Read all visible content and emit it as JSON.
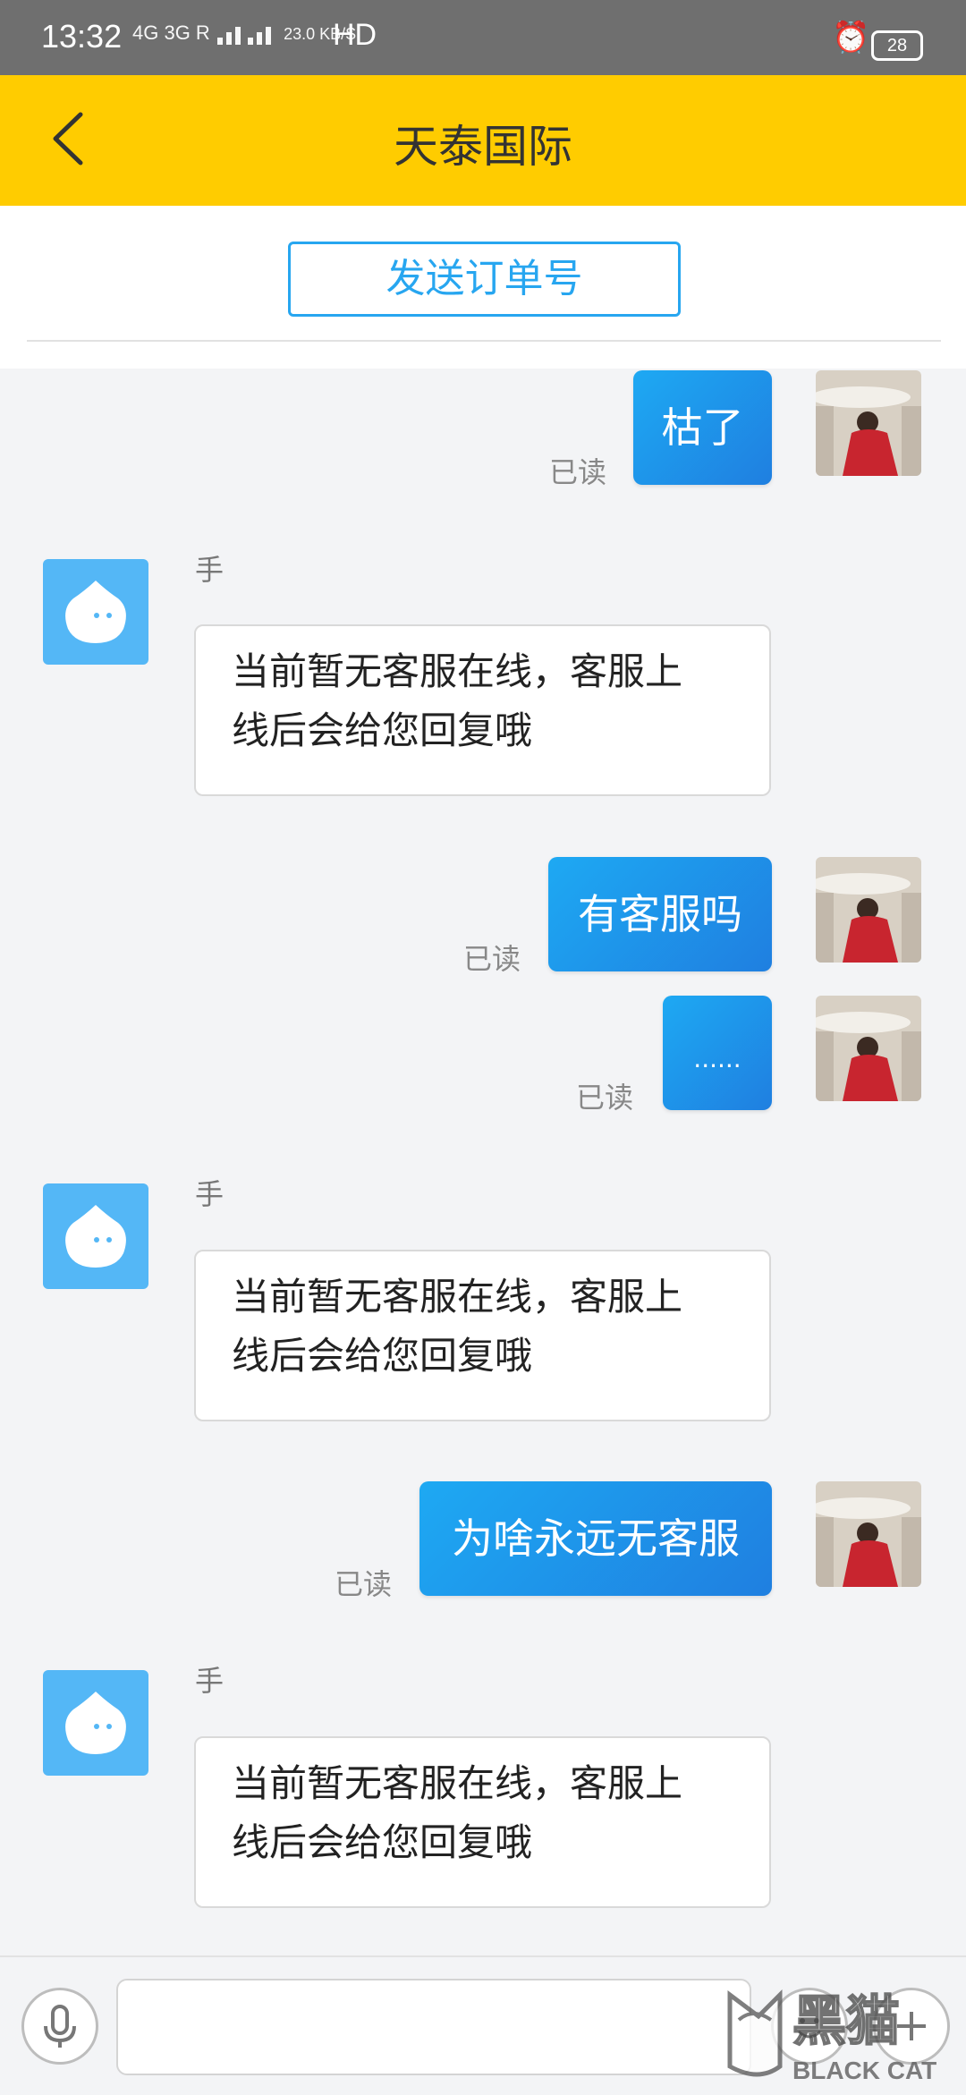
{
  "status_bar": {
    "time": "13:32",
    "network": "4G 3G R",
    "speed": "23.0 KB/S",
    "hd": "HD",
    "battery": "28"
  },
  "header": {
    "title": "天泰国际"
  },
  "order_button": {
    "label": "发送订单号"
  },
  "messages": [
    {
      "side": "right",
      "text": "枯了",
      "read": "已读"
    },
    {
      "side": "left",
      "name": "手",
      "text_line1": "当前暂无客服在线，客服上",
      "text_line2": "线后会给您回复哦"
    },
    {
      "side": "right",
      "text": "有客服吗",
      "read": "已读"
    },
    {
      "side": "right",
      "text": "......",
      "read": "已读"
    },
    {
      "side": "left",
      "name": "手",
      "text_line1": "当前暂无客服在线，客服上",
      "text_line2": "线后会给您回复哦"
    },
    {
      "side": "right",
      "text": "为啥永远无客服",
      "read": "已读"
    },
    {
      "side": "left",
      "name": "手",
      "text_line1": "当前暂无客服在线，客服上",
      "text_line2": "线后会给您回复哦"
    }
  ],
  "composer": {
    "input_value": "",
    "icons": [
      "mic-icon",
      "emoji-icon",
      "add-icon"
    ]
  },
  "watermark": {
    "line1": "黑猫",
    "line2": "BLACK CAT"
  },
  "colors": {
    "header": "#ffcc00",
    "accent": "#27a6f0",
    "bubble": "#1ea9f3",
    "bot_avatar": "#54b7f6"
  }
}
